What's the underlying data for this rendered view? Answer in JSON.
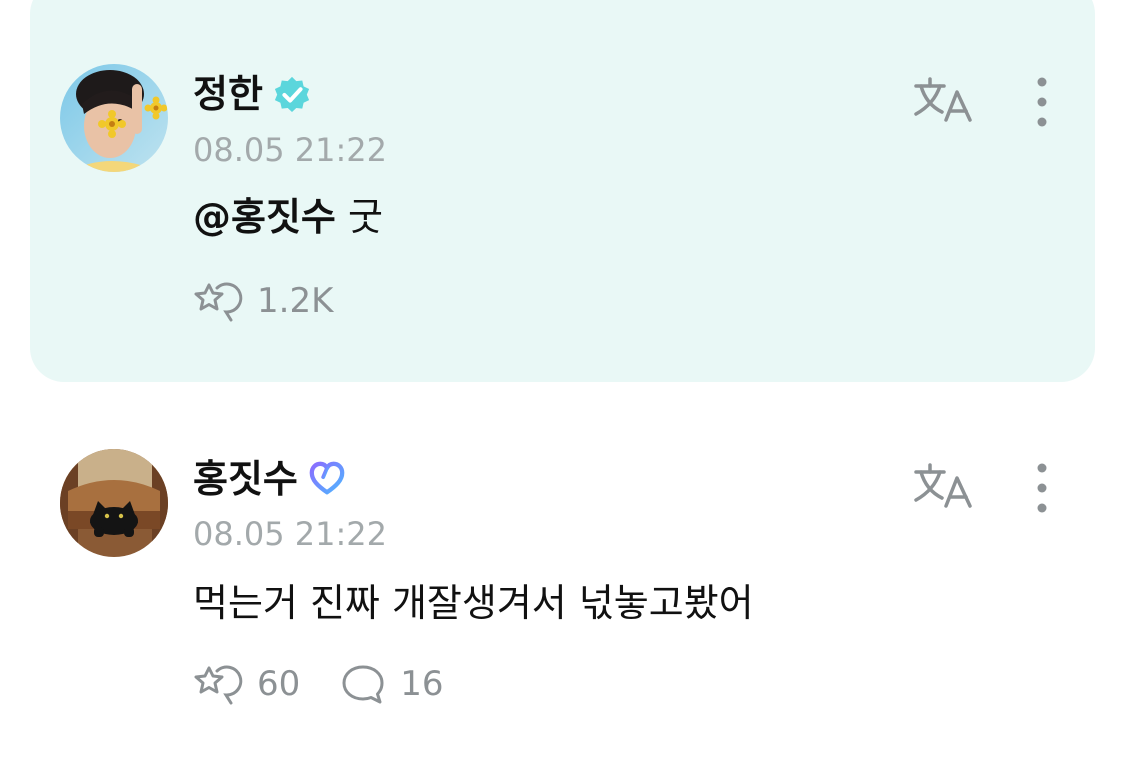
{
  "comments": [
    {
      "author": "정한",
      "timestamp": "08.05 21:22",
      "mention": "@홍짓수",
      "text": "굿",
      "likes": "1.2K",
      "badge_color": "#5bd6dc",
      "highlighted": true
    },
    {
      "author": "홍짓수",
      "timestamp": "08.05 21:22",
      "text": "먹는거 진짜 개잘생겨서 넋놓고봤어",
      "likes": "60",
      "replies": "16",
      "badge_color": "#6c8cff",
      "highlighted": false
    }
  ],
  "colors": {
    "highlight_bg": "#e9f8f6",
    "muted_text": "#a3a9ab",
    "icon_gray": "#8c9194"
  },
  "icons": {
    "translate": "translate-icon",
    "more": "more-vertical-icon",
    "like": "like-icon",
    "reply": "reply-icon"
  }
}
